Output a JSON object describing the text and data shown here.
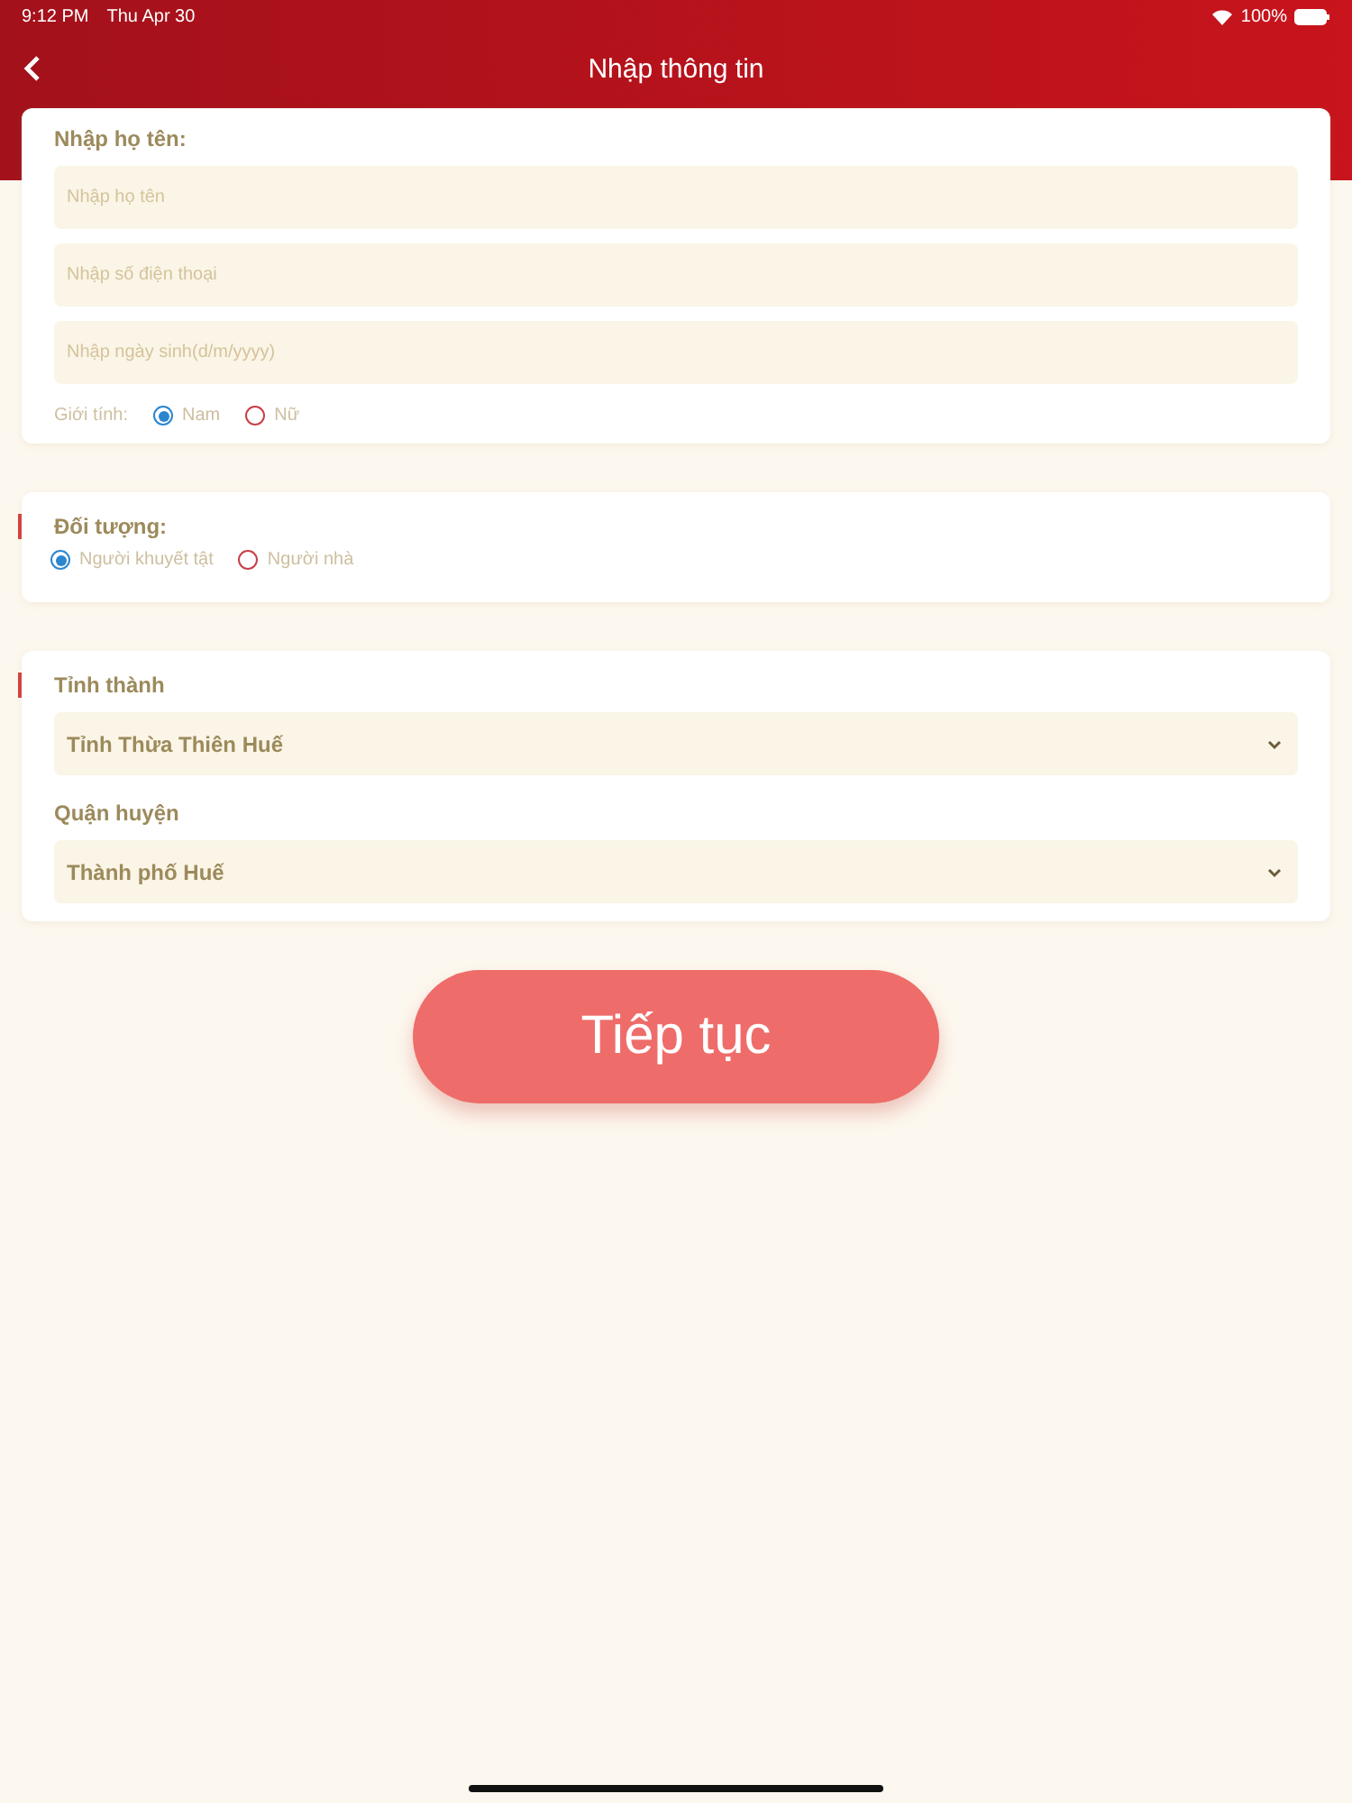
{
  "status_bar": {
    "time": "9:12 PM",
    "date": "Thu Apr 30",
    "battery": "100%"
  },
  "header": {
    "title": "Nhập thông tin"
  },
  "personal": {
    "label": "Nhập họ tên:",
    "fields": [
      {
        "placeholder": "Nhập họ tên"
      },
      {
        "placeholder": "Nhập số điện thoại"
      },
      {
        "placeholder": "Nhập ngày sinh(d/m/yyyy)"
      }
    ],
    "gender": {
      "label": "Giới tính:",
      "options": [
        {
          "label": "Nam",
          "selected": true
        },
        {
          "label": "Nữ",
          "selected": false
        }
      ]
    }
  },
  "target": {
    "label": "Đối tượng:",
    "options": [
      {
        "label": "Người khuyết tật",
        "selected": true
      },
      {
        "label": "Người nhà",
        "selected": false
      }
    ]
  },
  "location": {
    "selects": [
      {
        "label": "Tỉnh thành",
        "value": "Tỉnh Thừa Thiên Huế"
      },
      {
        "label": "Quận huyện",
        "value": "Thành phố Huế"
      }
    ]
  },
  "button": "Tiếp tục"
}
